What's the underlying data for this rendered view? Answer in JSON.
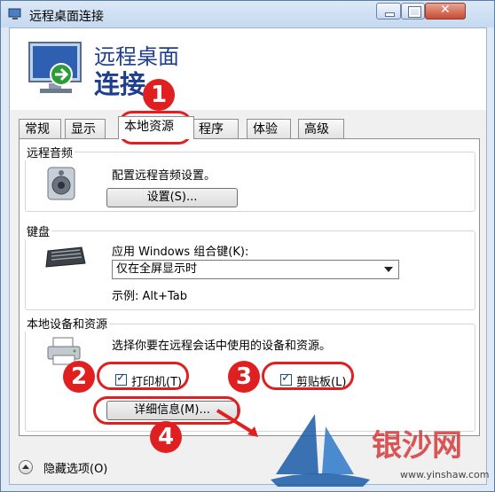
{
  "window": {
    "title": "远程桌面连接"
  },
  "header": {
    "line1": "远程桌面",
    "line2": "连接"
  },
  "tabs": [
    {
      "label": "常规"
    },
    {
      "label": "显示"
    },
    {
      "label": "本地资源",
      "active": true
    },
    {
      "label": "程序"
    },
    {
      "label": "体验"
    },
    {
      "label": "高级"
    }
  ],
  "remote_audio": {
    "group_title": "远程音频",
    "description": "配置远程音频设置。",
    "settings_button": "设置(S)..."
  },
  "keyboard": {
    "group_title": "键盘",
    "apply_label": "应用 Windows 组合键(K):",
    "selected": "仅在全屏显示时",
    "example": "示例: Alt+Tab"
  },
  "local_devices": {
    "group_title": "本地设备和资源",
    "description": "选择你要在远程会话中使用的设备和资源。",
    "printers": {
      "label": "打印机(T)",
      "checked": true
    },
    "clipboard": {
      "label": "剪贴板(L)",
      "checked": true
    },
    "details_button": "详细信息(M)..."
  },
  "markers": [
    "1",
    "2",
    "3",
    "4"
  ],
  "footer": {
    "hide_options": "隐藏选项(O)"
  },
  "watermark": {
    "text": "银沙网",
    "url": "www.yinshaw.com"
  },
  "colors": {
    "annotation_red": "#e02020",
    "heading_blue": "#1e3f8f",
    "watermark_blue": "#1a5aa8"
  }
}
